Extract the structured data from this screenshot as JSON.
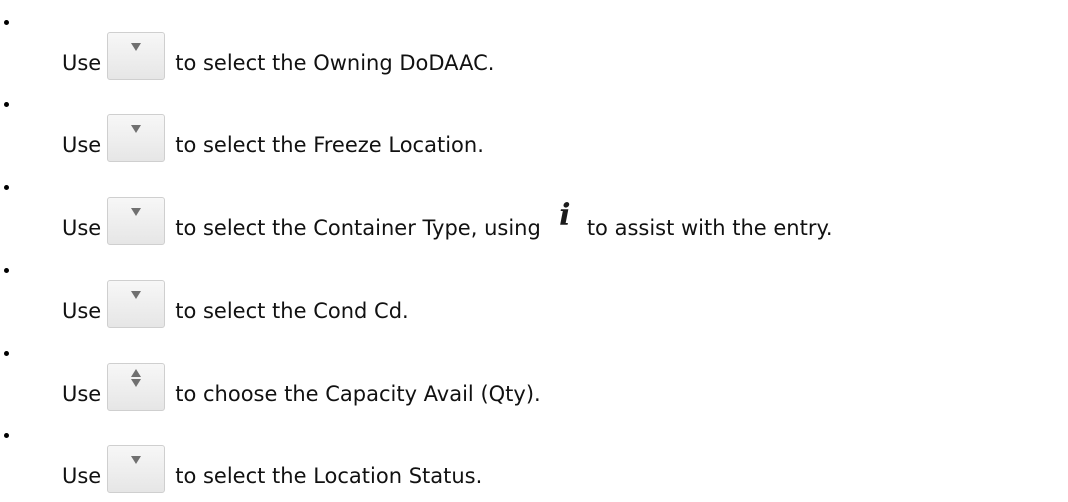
{
  "items": [
    {
      "prefix": "Use",
      "control": "dropdown-arrow",
      "suffix": "to select the Owning DoDAAC."
    },
    {
      "prefix": "Use",
      "control": "dropdown-arrow",
      "suffix": "to select the Freeze Location."
    },
    {
      "prefix": "Use",
      "control": "dropdown-arrow",
      "suffix": "to select the Container Type, using",
      "info_icon": "info-icon",
      "suffix2": "to assist with the entry."
    },
    {
      "prefix": "Use",
      "control": "dropdown-arrow",
      "suffix": "to select the Cond Cd."
    },
    {
      "prefix": "Use",
      "control": "spinner-arrows",
      "suffix": "to choose the Capacity Avail (Qty)."
    },
    {
      "prefix": "Use",
      "control": "dropdown-arrow",
      "suffix": "to select the Location Status."
    }
  ]
}
